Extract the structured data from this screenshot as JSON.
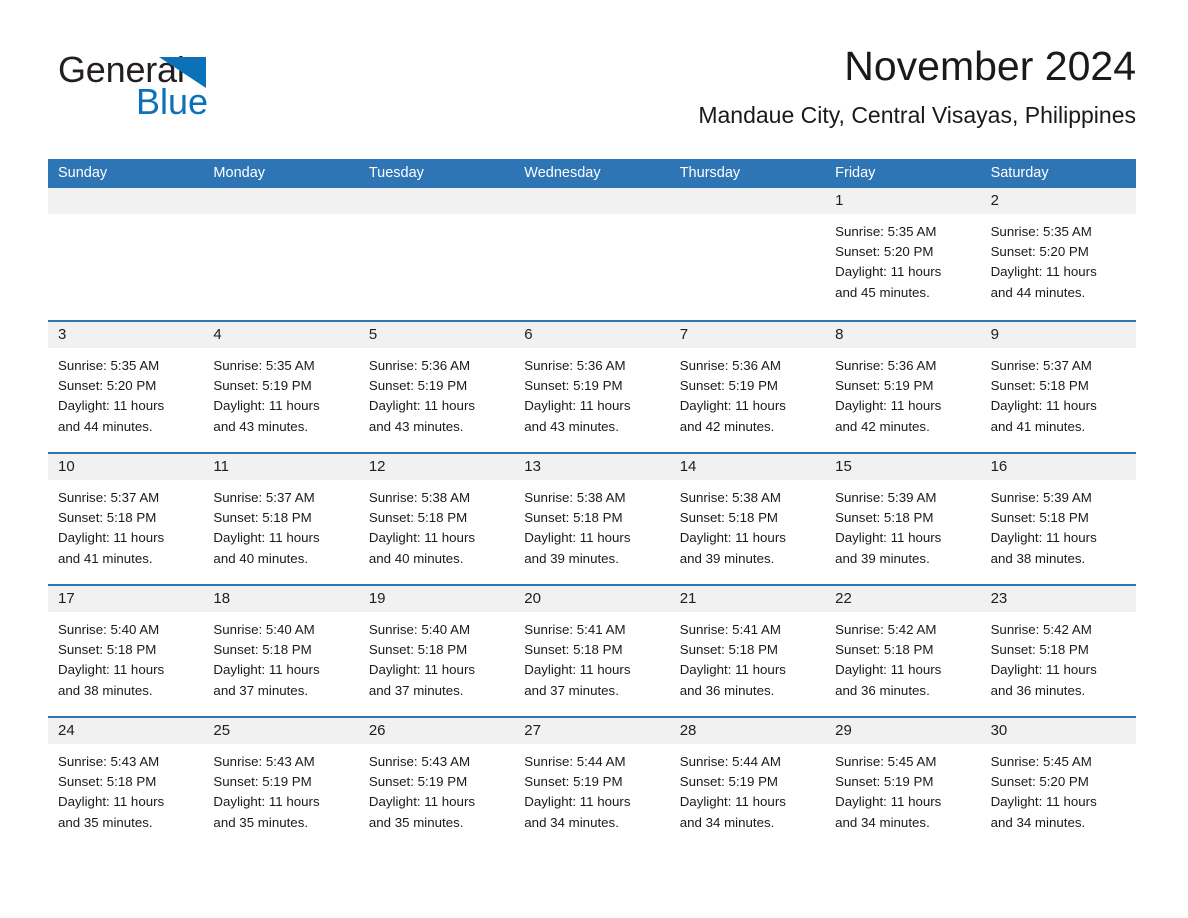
{
  "brand": {
    "name_part1": "General",
    "name_part2": "Blue",
    "logo_icon": "triangle-icon",
    "accent_color": "#0b72b9"
  },
  "header": {
    "title": "November 2024",
    "subtitle": "Mandaue City, Central Visayas, Philippines"
  },
  "theme": {
    "header_row_bg": "#2e75b6",
    "day_number_band_bg": "#f1f1f1",
    "row_divider": "#2e75b6",
    "text_color": "#1a1a1a"
  },
  "weekdays": [
    "Sunday",
    "Monday",
    "Tuesday",
    "Wednesday",
    "Thursday",
    "Friday",
    "Saturday"
  ],
  "weeks": [
    [
      {
        "day": "",
        "sunrise": "",
        "sunset": "",
        "daylight_line1": "",
        "daylight_line2": "",
        "empty": true
      },
      {
        "day": "",
        "sunrise": "",
        "sunset": "",
        "daylight_line1": "",
        "daylight_line2": "",
        "empty": true
      },
      {
        "day": "",
        "sunrise": "",
        "sunset": "",
        "daylight_line1": "",
        "daylight_line2": "",
        "empty": true
      },
      {
        "day": "",
        "sunrise": "",
        "sunset": "",
        "daylight_line1": "",
        "daylight_line2": "",
        "empty": true
      },
      {
        "day": "",
        "sunrise": "",
        "sunset": "",
        "daylight_line1": "",
        "daylight_line2": "",
        "empty": true
      },
      {
        "day": "1",
        "sunrise": "Sunrise: 5:35 AM",
        "sunset": "Sunset: 5:20 PM",
        "daylight_line1": "Daylight: 11 hours",
        "daylight_line2": "and 45 minutes.",
        "empty": false
      },
      {
        "day": "2",
        "sunrise": "Sunrise: 5:35 AM",
        "sunset": "Sunset: 5:20 PM",
        "daylight_line1": "Daylight: 11 hours",
        "daylight_line2": "and 44 minutes.",
        "empty": false
      }
    ],
    [
      {
        "day": "3",
        "sunrise": "Sunrise: 5:35 AM",
        "sunset": "Sunset: 5:20 PM",
        "daylight_line1": "Daylight: 11 hours",
        "daylight_line2": "and 44 minutes.",
        "empty": false
      },
      {
        "day": "4",
        "sunrise": "Sunrise: 5:35 AM",
        "sunset": "Sunset: 5:19 PM",
        "daylight_line1": "Daylight: 11 hours",
        "daylight_line2": "and 43 minutes.",
        "empty": false
      },
      {
        "day": "5",
        "sunrise": "Sunrise: 5:36 AM",
        "sunset": "Sunset: 5:19 PM",
        "daylight_line1": "Daylight: 11 hours",
        "daylight_line2": "and 43 minutes.",
        "empty": false
      },
      {
        "day": "6",
        "sunrise": "Sunrise: 5:36 AM",
        "sunset": "Sunset: 5:19 PM",
        "daylight_line1": "Daylight: 11 hours",
        "daylight_line2": "and 43 minutes.",
        "empty": false
      },
      {
        "day": "7",
        "sunrise": "Sunrise: 5:36 AM",
        "sunset": "Sunset: 5:19 PM",
        "daylight_line1": "Daylight: 11 hours",
        "daylight_line2": "and 42 minutes.",
        "empty": false
      },
      {
        "day": "8",
        "sunrise": "Sunrise: 5:36 AM",
        "sunset": "Sunset: 5:19 PM",
        "daylight_line1": "Daylight: 11 hours",
        "daylight_line2": "and 42 minutes.",
        "empty": false
      },
      {
        "day": "9",
        "sunrise": "Sunrise: 5:37 AM",
        "sunset": "Sunset: 5:18 PM",
        "daylight_line1": "Daylight: 11 hours",
        "daylight_line2": "and 41 minutes.",
        "empty": false
      }
    ],
    [
      {
        "day": "10",
        "sunrise": "Sunrise: 5:37 AM",
        "sunset": "Sunset: 5:18 PM",
        "daylight_line1": "Daylight: 11 hours",
        "daylight_line2": "and 41 minutes.",
        "empty": false
      },
      {
        "day": "11",
        "sunrise": "Sunrise: 5:37 AM",
        "sunset": "Sunset: 5:18 PM",
        "daylight_line1": "Daylight: 11 hours",
        "daylight_line2": "and 40 minutes.",
        "empty": false
      },
      {
        "day": "12",
        "sunrise": "Sunrise: 5:38 AM",
        "sunset": "Sunset: 5:18 PM",
        "daylight_line1": "Daylight: 11 hours",
        "daylight_line2": "and 40 minutes.",
        "empty": false
      },
      {
        "day": "13",
        "sunrise": "Sunrise: 5:38 AM",
        "sunset": "Sunset: 5:18 PM",
        "daylight_line1": "Daylight: 11 hours",
        "daylight_line2": "and 39 minutes.",
        "empty": false
      },
      {
        "day": "14",
        "sunrise": "Sunrise: 5:38 AM",
        "sunset": "Sunset: 5:18 PM",
        "daylight_line1": "Daylight: 11 hours",
        "daylight_line2": "and 39 minutes.",
        "empty": false
      },
      {
        "day": "15",
        "sunrise": "Sunrise: 5:39 AM",
        "sunset": "Sunset: 5:18 PM",
        "daylight_line1": "Daylight: 11 hours",
        "daylight_line2": "and 39 minutes.",
        "empty": false
      },
      {
        "day": "16",
        "sunrise": "Sunrise: 5:39 AM",
        "sunset": "Sunset: 5:18 PM",
        "daylight_line1": "Daylight: 11 hours",
        "daylight_line2": "and 38 minutes.",
        "empty": false
      }
    ],
    [
      {
        "day": "17",
        "sunrise": "Sunrise: 5:40 AM",
        "sunset": "Sunset: 5:18 PM",
        "daylight_line1": "Daylight: 11 hours",
        "daylight_line2": "and 38 minutes.",
        "empty": false
      },
      {
        "day": "18",
        "sunrise": "Sunrise: 5:40 AM",
        "sunset": "Sunset: 5:18 PM",
        "daylight_line1": "Daylight: 11 hours",
        "daylight_line2": "and 37 minutes.",
        "empty": false
      },
      {
        "day": "19",
        "sunrise": "Sunrise: 5:40 AM",
        "sunset": "Sunset: 5:18 PM",
        "daylight_line1": "Daylight: 11 hours",
        "daylight_line2": "and 37 minutes.",
        "empty": false
      },
      {
        "day": "20",
        "sunrise": "Sunrise: 5:41 AM",
        "sunset": "Sunset: 5:18 PM",
        "daylight_line1": "Daylight: 11 hours",
        "daylight_line2": "and 37 minutes.",
        "empty": false
      },
      {
        "day": "21",
        "sunrise": "Sunrise: 5:41 AM",
        "sunset": "Sunset: 5:18 PM",
        "daylight_line1": "Daylight: 11 hours",
        "daylight_line2": "and 36 minutes.",
        "empty": false
      },
      {
        "day": "22",
        "sunrise": "Sunrise: 5:42 AM",
        "sunset": "Sunset: 5:18 PM",
        "daylight_line1": "Daylight: 11 hours",
        "daylight_line2": "and 36 minutes.",
        "empty": false
      },
      {
        "day": "23",
        "sunrise": "Sunrise: 5:42 AM",
        "sunset": "Sunset: 5:18 PM",
        "daylight_line1": "Daylight: 11 hours",
        "daylight_line2": "and 36 minutes.",
        "empty": false
      }
    ],
    [
      {
        "day": "24",
        "sunrise": "Sunrise: 5:43 AM",
        "sunset": "Sunset: 5:18 PM",
        "daylight_line1": "Daylight: 11 hours",
        "daylight_line2": "and 35 minutes.",
        "empty": false
      },
      {
        "day": "25",
        "sunrise": "Sunrise: 5:43 AM",
        "sunset": "Sunset: 5:19 PM",
        "daylight_line1": "Daylight: 11 hours",
        "daylight_line2": "and 35 minutes.",
        "empty": false
      },
      {
        "day": "26",
        "sunrise": "Sunrise: 5:43 AM",
        "sunset": "Sunset: 5:19 PM",
        "daylight_line1": "Daylight: 11 hours",
        "daylight_line2": "and 35 minutes.",
        "empty": false
      },
      {
        "day": "27",
        "sunrise": "Sunrise: 5:44 AM",
        "sunset": "Sunset: 5:19 PM",
        "daylight_line1": "Daylight: 11 hours",
        "daylight_line2": "and 34 minutes.",
        "empty": false
      },
      {
        "day": "28",
        "sunrise": "Sunrise: 5:44 AM",
        "sunset": "Sunset: 5:19 PM",
        "daylight_line1": "Daylight: 11 hours",
        "daylight_line2": "and 34 minutes.",
        "empty": false
      },
      {
        "day": "29",
        "sunrise": "Sunrise: 5:45 AM",
        "sunset": "Sunset: 5:19 PM",
        "daylight_line1": "Daylight: 11 hours",
        "daylight_line2": "and 34 minutes.",
        "empty": false
      },
      {
        "day": "30",
        "sunrise": "Sunrise: 5:45 AM",
        "sunset": "Sunset: 5:20 PM",
        "daylight_line1": "Daylight: 11 hours",
        "daylight_line2": "and 34 minutes.",
        "empty": false
      }
    ]
  ]
}
